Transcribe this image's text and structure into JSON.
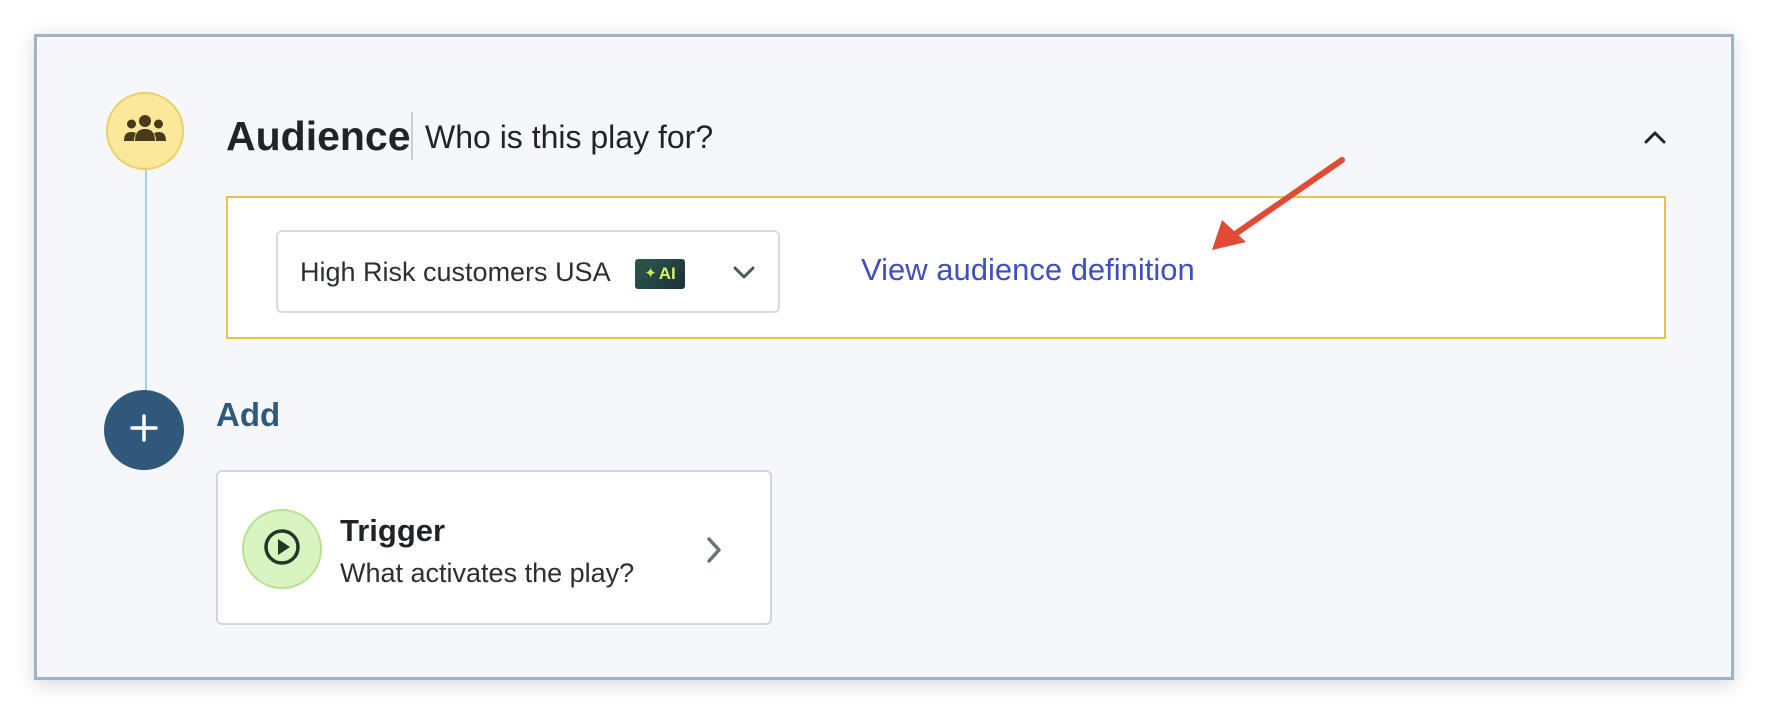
{
  "audience": {
    "title": "Audience",
    "subtitle": "Who is this play for?",
    "icon": "people-group-icon",
    "selected_audience": "High Risk customers USA",
    "ai_badge": "AI",
    "view_link": "View audience definition"
  },
  "add": {
    "label": "Add",
    "icon": "plus-icon"
  },
  "trigger": {
    "title": "Trigger",
    "description": "What activates the play?",
    "icon": "play-circle-icon"
  },
  "colors": {
    "audience_accent": "#fbe89a",
    "audience_border": "#e6c449",
    "add_button": "#2f587a",
    "link": "#3f4fbb",
    "trigger_accent": "#d9f3c1",
    "annotation_arrow": "#e04a36"
  }
}
